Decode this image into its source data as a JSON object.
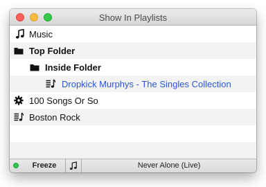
{
  "window": {
    "title": "Show In Playlists"
  },
  "playlists": [
    {
      "label": "Music",
      "icon": "music-note-icon",
      "bold": false,
      "selected": false
    },
    {
      "label": "Top Folder",
      "icon": "folder-icon",
      "bold": true,
      "selected": false
    },
    {
      "label": "Inside Folder",
      "icon": "folder-icon",
      "bold": true,
      "selected": false
    },
    {
      "label": "Dropkick Murphys - The Singles Collection",
      "icon": "playlist-icon",
      "bold": false,
      "selected": true
    },
    {
      "label": "100 Songs Or So",
      "icon": "smart-playlist-gear-icon",
      "bold": false,
      "selected": false
    },
    {
      "label": "Boston Rock",
      "icon": "playlist-icon",
      "bold": false,
      "selected": false
    }
  ],
  "statusbar": {
    "freeze_label": "Freeze",
    "now_playing": "Never Alone (Live)",
    "status_color": "#35c24a"
  },
  "colors": {
    "selected_text": "#2a57d6",
    "alt_row": "#f3f3f3"
  }
}
